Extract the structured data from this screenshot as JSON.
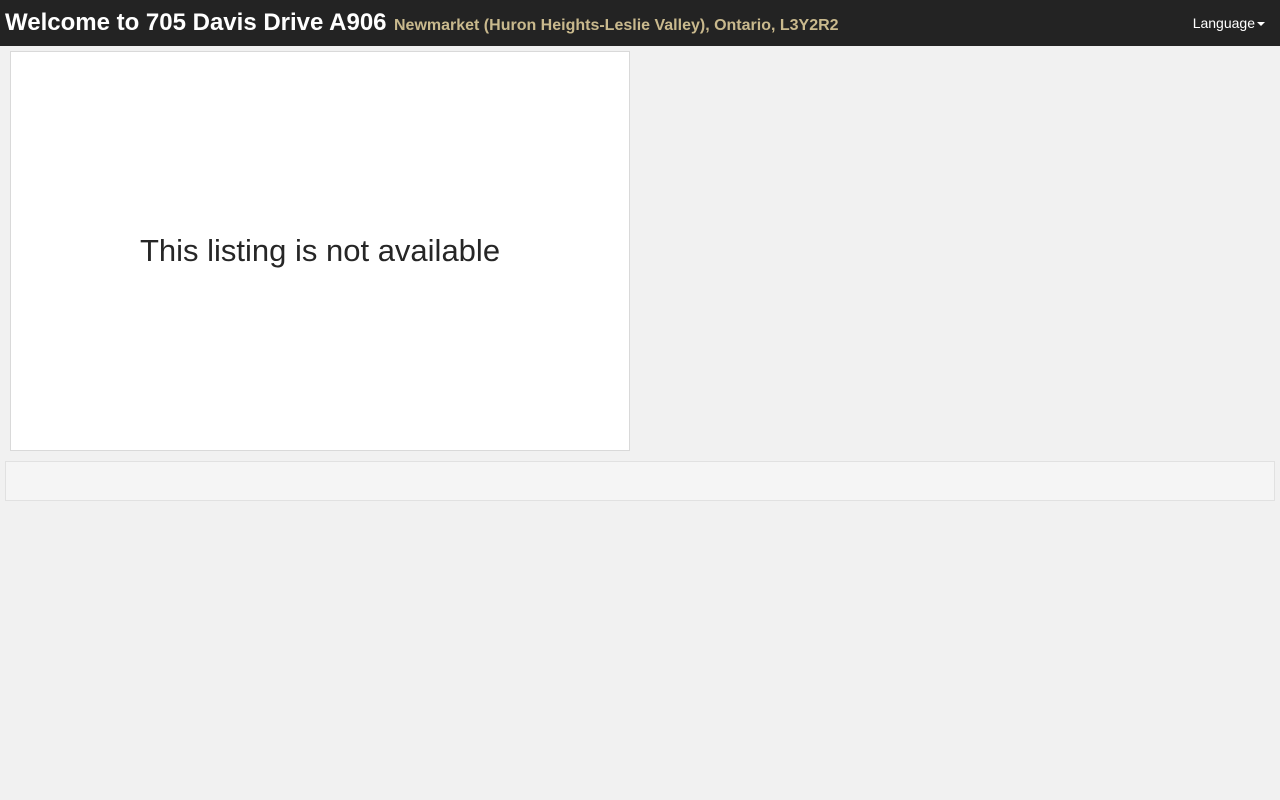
{
  "header": {
    "title": "Welcome to 705 Davis Drive A906",
    "location": "Newmarket (Huron Heights-Leslie Valley), Ontario, L3Y2R2",
    "language_label": "Language"
  },
  "listing": {
    "message": "This listing is not available"
  },
  "colors": {
    "header_bg": "#232323",
    "location_text": "#c9b98d",
    "page_bg": "#f1f1f1"
  }
}
